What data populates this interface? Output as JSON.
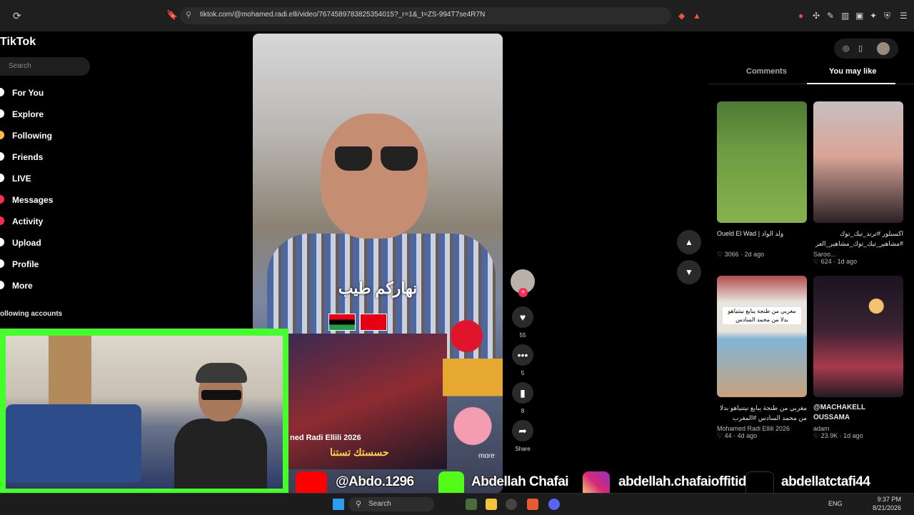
{
  "browser": {
    "url": "tiktok.com/@mohamed.radi.elli/video/7674589783825354015?_r=1&_t=ZS-994T7se4R7N"
  },
  "sidebar": {
    "logo": "TikTok",
    "search_placeholder": "Search",
    "items": [
      {
        "label": "For You"
      },
      {
        "label": "Explore"
      },
      {
        "label": "Following"
      },
      {
        "label": "Friends"
      },
      {
        "label": "LIVE"
      },
      {
        "label": "Messages"
      },
      {
        "label": "Activity"
      },
      {
        "label": "Upload"
      },
      {
        "label": "Profile"
      },
      {
        "label": "More"
      }
    ],
    "following_accounts": "ollowing accounts"
  },
  "video": {
    "caption": "نهاركم طيب",
    "inner_title": "ned Radi Ellili 2026",
    "inner_overlay": "حسستك تستنا",
    "more": "more"
  },
  "actions": {
    "likes": "55",
    "comments": "5",
    "saves": "8",
    "share": "Share"
  },
  "right": {
    "tabs": {
      "comments": "Comments",
      "you_may_like": "You may like"
    },
    "cards": [
      {
        "title": "Oueld El Wad | ولد الواد",
        "author": "",
        "likes": "3066",
        "age": "2d ago"
      },
      {
        "title": "اكسبلور #ترند_تيك_توك #مشاهير_تيك_توك_مشاهير_العر",
        "author": "Saroo...",
        "likes": "624",
        "age": "1d ago"
      },
      {
        "title": "مغربي من طنجة يبايع نيتنياهو بدلا من محمد السادس #المغرب",
        "author": "Mohamed Radi Ellili 2026",
        "likes": "44",
        "age": "4d ago"
      },
      {
        "title": "@MACHAKELL OUSSAMA",
        "author": "adam",
        "likes": "23.9K",
        "age": "1d ago"
      }
    ],
    "card3_overlay_line1": "مغربي من طنجة يبايع نيتنياهو",
    "card3_overlay_line2": "بدلا من محمد السادس"
  },
  "banner": {
    "youtube": "@Abdo.1296",
    "kick": "Abdellah Chafai",
    "instagram": "abdellah.chafaioffitid",
    "tiktok": "abdellatctafi44"
  },
  "taskbar": {
    "search": "Search",
    "lang": "ENG",
    "time": "9:37 PM",
    "date": "8/21/2026"
  },
  "colors": {
    "accent": "#fe2c55",
    "webcam_border": "#45ff2c"
  }
}
